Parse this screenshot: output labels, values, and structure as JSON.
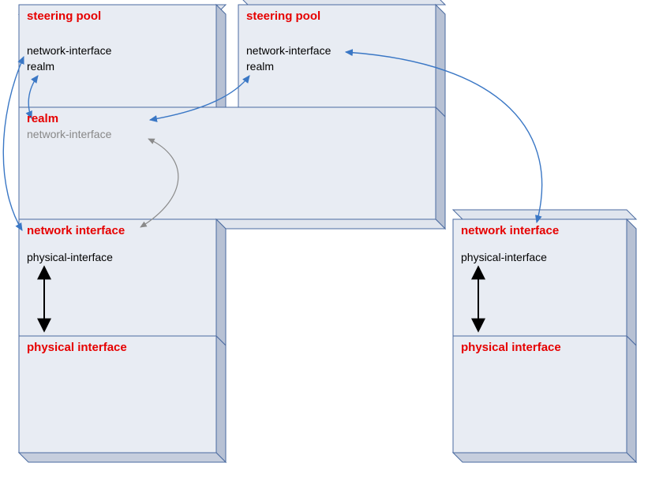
{
  "colors": {
    "box_fill": "#e8ecf3",
    "box_stroke": "#4a6aa0",
    "shadow_fill": "#ccd2de",
    "title": "#e60000",
    "blue_arrow": "#3a77c5",
    "grey_arrow": "#8a8a8a",
    "black_arrow": "#000000"
  },
  "left_stack": {
    "steering_pool": {
      "title": "steering pool",
      "fields": {
        "a": "network-interface",
        "b": "realm"
      }
    },
    "realm": {
      "title": "realm",
      "fields": {
        "a": "network-interface"
      }
    },
    "network_interface": {
      "title": "network interface",
      "fields": {
        "a": "physical-interface"
      }
    },
    "physical_interface": {
      "title": "physical interface"
    }
  },
  "top_right": {
    "steering_pool": {
      "title": "steering pool",
      "fields": {
        "a": "network-interface",
        "b": "realm"
      }
    }
  },
  "right_stack": {
    "network_interface": {
      "title": "network interface",
      "fields": {
        "a": "physical-interface"
      }
    },
    "physical_interface": {
      "title": "physical interface"
    }
  }
}
